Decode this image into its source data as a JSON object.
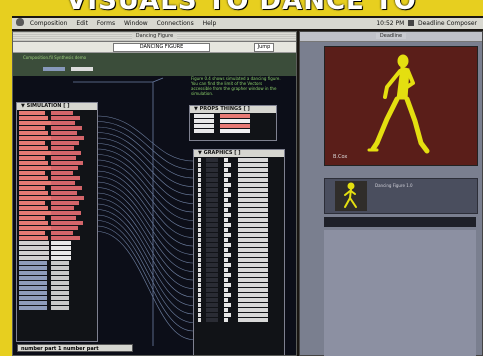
{
  "banner": {
    "headline": "VISUALS TO DANCE TO"
  },
  "menubar": {
    "items": [
      "Composition",
      "Edit",
      "Forms",
      "Window",
      "Connections",
      "Help"
    ],
    "clock": "10:52 PM",
    "app_name": "Deadline Composer"
  },
  "main_window": {
    "title": "Dancing Figure",
    "toolbar_field": "DANCING FIGURE",
    "toolbar_button": "Jump",
    "subbar_text": "Composition.fil  Synthesis demo",
    "note": "Figure 0.4 shows simulated a dancing figure. You can find the limit of the Vectors accessible from the grapher window in the simulation.",
    "panels": {
      "simulation": "SIMULATION",
      "props": "PROPS THINGS",
      "graphics": "GRAPHICS"
    },
    "footer_panel": "number part 1   number part"
  },
  "right_window": {
    "title": "Deadline",
    "preview_label": "B.Cox",
    "clip_caption": "Dancing Figure 1.0",
    "figure_color": "#e4df10"
  },
  "colors": {
    "frame_yellow": "#e7cf1f",
    "sim_label": "#e77a74",
    "sim_value": "#d3656a",
    "canvas": "#0c0e18",
    "wire": "#8aa0c8"
  }
}
